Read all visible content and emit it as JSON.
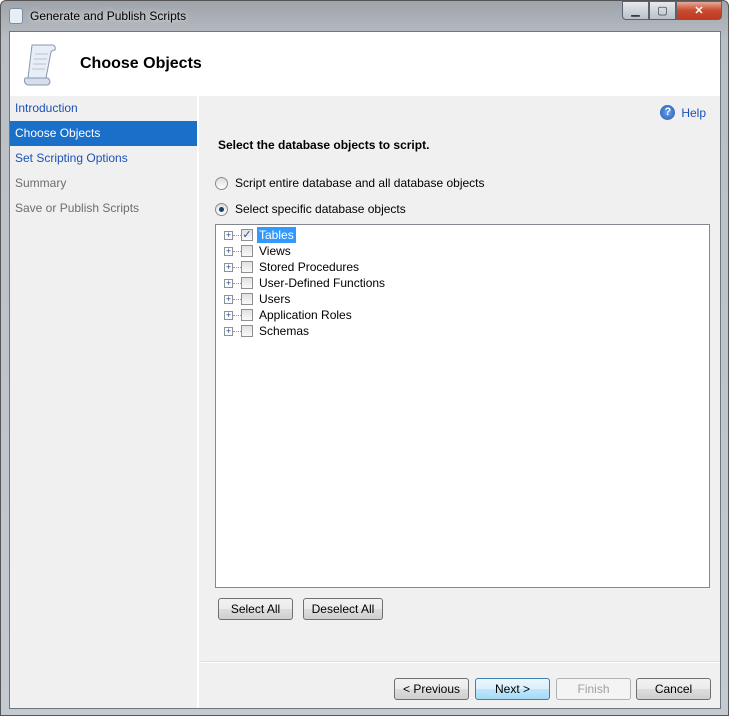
{
  "window": {
    "title": "Generate and Publish Scripts"
  },
  "header": {
    "title": "Choose Objects"
  },
  "sidebar": {
    "items": [
      {
        "label": "Introduction",
        "state": "link"
      },
      {
        "label": "Choose Objects",
        "state": "active"
      },
      {
        "label": "Set Scripting Options",
        "state": "link"
      },
      {
        "label": "Summary",
        "state": "disabled"
      },
      {
        "label": "Save or Publish Scripts",
        "state": "disabled"
      }
    ]
  },
  "main": {
    "help": "Help",
    "instruction": "Select the database objects to script.",
    "radio_entire": "Script entire database and all database objects",
    "radio_specific": "Select specific database objects",
    "selected_radio": "specific",
    "tree": [
      {
        "label": "Tables",
        "checked": true,
        "selected": true
      },
      {
        "label": "Views",
        "checked": false
      },
      {
        "label": "Stored Procedures",
        "checked": false
      },
      {
        "label": "User-Defined Functions",
        "checked": false
      },
      {
        "label": "Users",
        "checked": false
      },
      {
        "label": "Application Roles",
        "checked": false
      },
      {
        "label": "Schemas",
        "checked": false
      }
    ],
    "select_all": "Select All",
    "deselect_all": "Deselect All"
  },
  "footer": {
    "previous": "< Previous",
    "next": "Next >",
    "finish": "Finish",
    "cancel": "Cancel"
  },
  "colors": {
    "accent": "#1a6fc9",
    "link": "#1a52b8"
  }
}
